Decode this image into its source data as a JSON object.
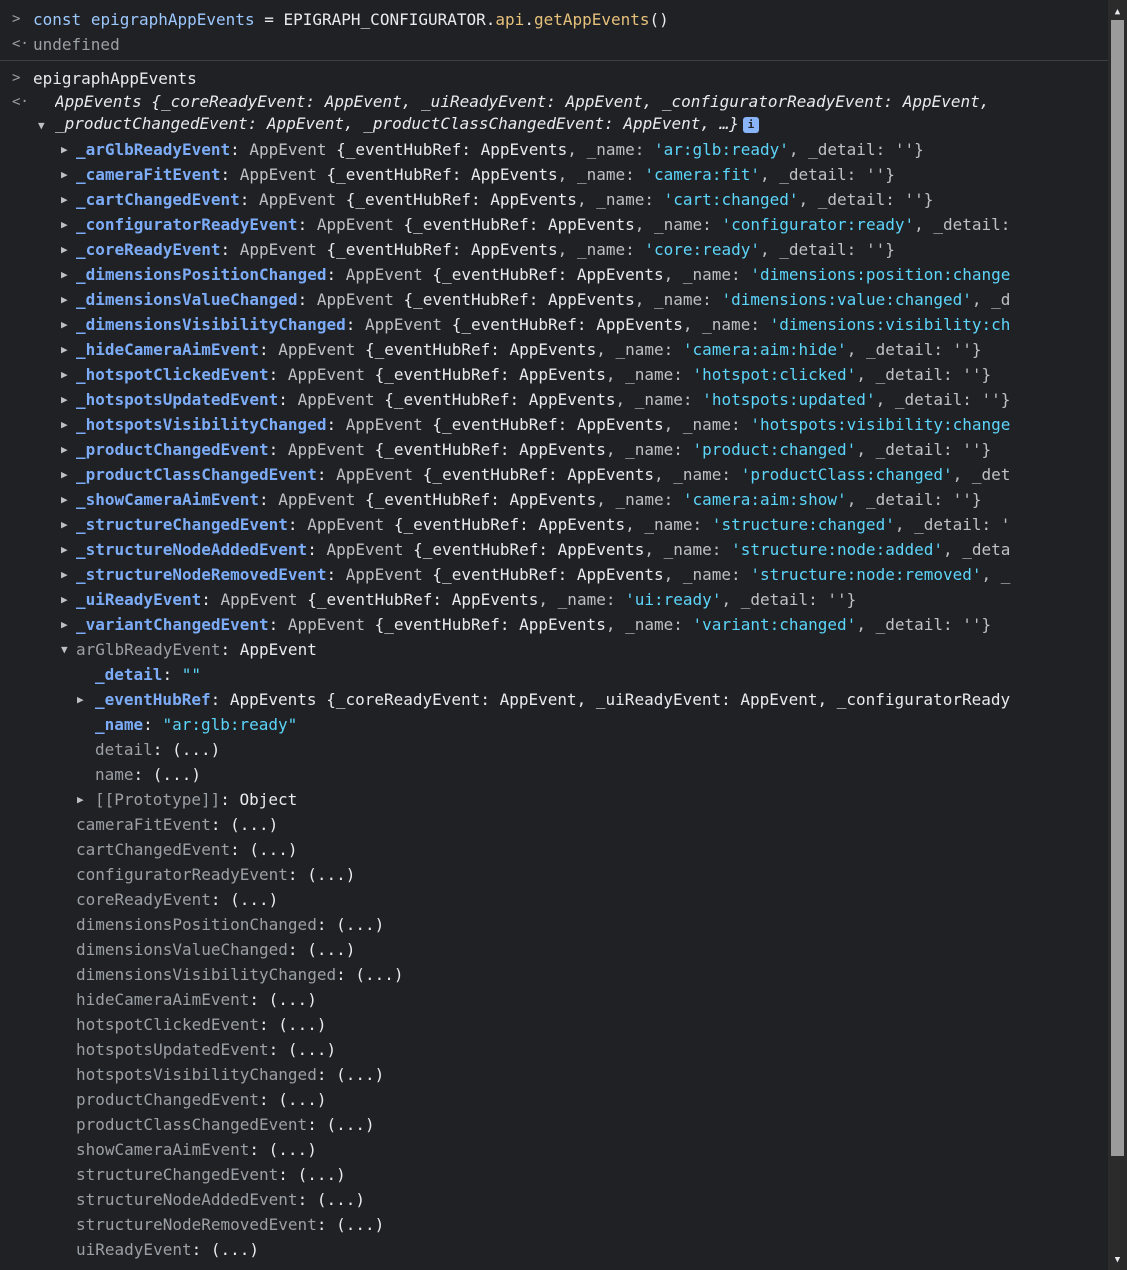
{
  "console": {
    "command1": {
      "keyword": "const",
      "var": "epigraphAppEvents",
      "eq": " = ",
      "obj": "EPIGRAPH_CONFIGURATOR.",
      "api": "api",
      "dot": ".",
      "method": "getAppEvents",
      "parens": "()"
    },
    "result1": "undefined",
    "command2": "epigraphAppEvents",
    "prompt_in": ">",
    "prompt_out": "<·"
  },
  "result_header": {
    "line1": "AppEvents {_coreReadyEvent: AppEvent, _uiReadyEvent: AppEvent, _configuratorReadyEvent: AppEvent,",
    "line2": "_productChangedEvent: AppEvent, _productClassChangedEvent: AppEvent, …}",
    "info_icon": "i"
  },
  "events": [
    {
      "key": "_arGlbReadyEvent",
      "name": "ar:glb:ready",
      "tail": ", _detail: ''}"
    },
    {
      "key": "_cameraFitEvent",
      "name": "camera:fit",
      "tail": ", _detail: ''}"
    },
    {
      "key": "_cartChangedEvent",
      "name": "cart:changed",
      "tail": ", _detail: ''}"
    },
    {
      "key": "_configuratorReadyEvent",
      "name": "configurator:ready",
      "tail": ", _detail:"
    },
    {
      "key": "_coreReadyEvent",
      "name": "core:ready",
      "tail": ", _detail: ''}"
    },
    {
      "key": "_dimensionsPositionChanged",
      "name": "dimensions:position:change",
      "tail": ""
    },
    {
      "key": "_dimensionsValueChanged",
      "name": "dimensions:value:changed",
      "tail": ", _d"
    },
    {
      "key": "_dimensionsVisibilityChanged",
      "name": "dimensions:visibility:ch",
      "tail": ""
    },
    {
      "key": "_hideCameraAimEvent",
      "name": "camera:aim:hide",
      "tail": ", _detail: ''}"
    },
    {
      "key": "_hotspotClickedEvent",
      "name": "hotspot:clicked",
      "tail": ", _detail: ''}"
    },
    {
      "key": "_hotspotsUpdatedEvent",
      "name": "hotspots:updated",
      "tail": ", _detail: ''}"
    },
    {
      "key": "_hotspotsVisibilityChanged",
      "name": "hotspots:visibility:change",
      "tail": ""
    },
    {
      "key": "_productChangedEvent",
      "name": "product:changed",
      "tail": ", _detail: ''}"
    },
    {
      "key": "_productClassChangedEvent",
      "name": "productClass:changed",
      "tail": ", _det"
    },
    {
      "key": "_showCameraAimEvent",
      "name": "camera:aim:show",
      "tail": ", _detail: ''}"
    },
    {
      "key": "_structureChangedEvent",
      "name": "structure:changed",
      "tail": ", _detail: '"
    },
    {
      "key": "_structureNodeAddedEvent",
      "name": "structure:node:added",
      "tail": ", _deta"
    },
    {
      "key": "_structureNodeRemovedEvent",
      "name": "structure:node:removed",
      "tail": ", _"
    },
    {
      "key": "_uiReadyEvent",
      "name": "ui:ready",
      "tail": ", _detail: ''}"
    },
    {
      "key": "_variantChangedEvent",
      "name": "variant:changed",
      "tail": ", _detail: ''}"
    }
  ],
  "labels": {
    "app_event": "AppEvent",
    "app_events": "AppEvents",
    "hub_ref": "{_eventHubRef: ",
    "name_key": ", _name: ",
    "colon": ": "
  },
  "expanded": {
    "key": "arGlbReadyEvent",
    "type": "AppEvent",
    "detail_key": "_detail",
    "detail_val": "\"\"",
    "hub_key": "_eventHubRef",
    "hub_val": "AppEvents {_coreReadyEvent: AppEvent, _uiReadyEvent: AppEvent, _configuratorReady",
    "name_key": "_name",
    "name_val": "\"ar:glb:ready\"",
    "getter_detail": "detail",
    "getter_name": "name",
    "proto_key": "[[Prototype]]",
    "proto_val": "Object",
    "lazy": "(...)"
  },
  "getters": [
    "cameraFitEvent",
    "cartChangedEvent",
    "configuratorReadyEvent",
    "coreReadyEvent",
    "dimensionsPositionChanged",
    "dimensionsValueChanged",
    "dimensionsVisibilityChanged",
    "hideCameraAimEvent",
    "hotspotClickedEvent",
    "hotspotsUpdatedEvent",
    "hotspotsVisibilityChanged",
    "productChangedEvent",
    "productClassChangedEvent",
    "showCameraAimEvent",
    "structureChangedEvent",
    "structureNodeAddedEvent",
    "structureNodeRemovedEvent",
    "uiReadyEvent"
  ],
  "colors": {
    "background": "#202124",
    "key": "#7cacf8",
    "string": "#5cd5fb",
    "dim_key": "#9aa0a6"
  }
}
